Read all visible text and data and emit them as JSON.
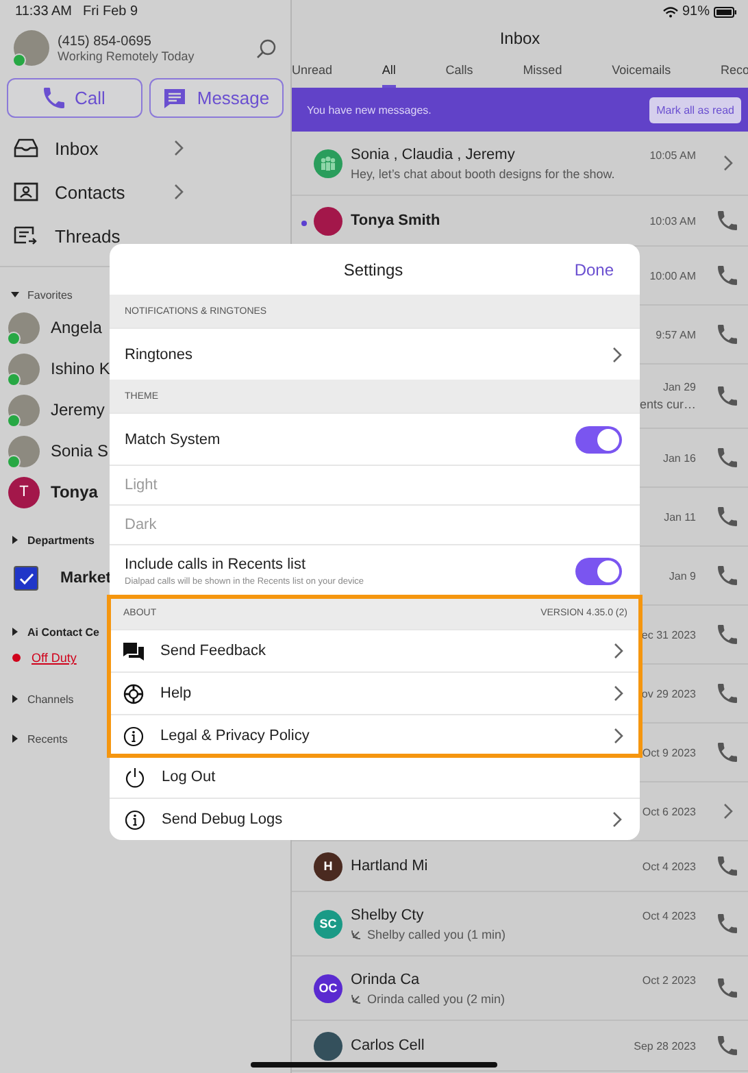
{
  "status_bar": {
    "time": "11:33 AM",
    "date": "Fri Feb 9",
    "battery": "91%"
  },
  "profile": {
    "phone": "(415) 854-0695",
    "status": "Working Remotely Today",
    "online": true
  },
  "actions": [
    {
      "kind": "call",
      "label": "Call"
    },
    {
      "kind": "message",
      "label": "Message"
    }
  ],
  "nav": [
    {
      "kind": "inbox",
      "label": "Inbox",
      "chevron": true
    },
    {
      "kind": "contacts",
      "label": "Contacts",
      "chevron": true
    },
    {
      "kind": "threads",
      "label": "Threads",
      "chevron": false
    }
  ],
  "sidebar_groups": [
    {
      "title": "Favorites",
      "expanded": true,
      "bold": false,
      "items": [
        {
          "kind": "contact",
          "name": "Angela",
          "online": true
        },
        {
          "kind": "contact",
          "name": "Ishino K",
          "online": true
        },
        {
          "kind": "contact",
          "name": "Jeremy",
          "online": true
        },
        {
          "kind": "contact",
          "name": "Sonia S",
          "online": true
        },
        {
          "kind": "contact",
          "name": "Tonya",
          "initial": "T",
          "color": "#a3174a",
          "online": false
        }
      ]
    },
    {
      "title": "Departments",
      "expanded": false,
      "bold": true,
      "items": [
        {
          "kind": "checkbox",
          "name": "Market",
          "checked": true
        }
      ]
    },
    {
      "title": "Ai Contact Ce",
      "expanded": false,
      "bold": true,
      "items": [
        {
          "kind": "status",
          "name": "Off Duty",
          "color": "#d0021b"
        }
      ]
    },
    {
      "title": "Channels",
      "expanded": false,
      "bold": false
    },
    {
      "title": "Recents",
      "expanded": false,
      "bold": false
    }
  ],
  "inbox": {
    "title": "Inbox",
    "tabs": [
      {
        "label": "Unread",
        "selected": false
      },
      {
        "label": "All",
        "selected": true
      },
      {
        "label": "Calls",
        "selected": false
      },
      {
        "label": "Missed",
        "selected": false
      },
      {
        "label": "Voicemails",
        "selected": false
      },
      {
        "label": "Reco",
        "selected": false
      }
    ],
    "banner": {
      "text": "You have new messages.",
      "button": "Mark all as read"
    },
    "rows": [
      {
        "avatar": {
          "kind": "group",
          "color": "#2a9d5c"
        },
        "name": "Sonia , Claudia , Jeremy",
        "time": "10:05 AM",
        "preview": "Hey, let’s chat about booth designs for the show.",
        "kind": "thread",
        "unread": false,
        "call_log": false
      },
      {
        "avatar": {
          "kind": "initials",
          "color": "#a3174a"
        },
        "name": "Tonya Smith",
        "time": "10:03 AM",
        "kind": "call",
        "unread": true
      },
      {
        "time": "10:00 AM",
        "kind": "call"
      },
      {
        "time": "9:57 AM",
        "kind": "call"
      },
      {
        "time": "Jan 29",
        "preview": "ents cur…",
        "kind": "call"
      },
      {
        "time": "Jan 16",
        "kind": "call"
      },
      {
        "time": "Jan 11",
        "kind": "call"
      },
      {
        "time": "Jan 9",
        "kind": "call"
      },
      {
        "time": "ec 31 2023",
        "kind": "call"
      },
      {
        "time": "ov 29 2023",
        "kind": "call"
      },
      {
        "time": "Oct 9 2023",
        "kind": "call"
      },
      {
        "time": "Oct 6 2023",
        "kind": "thread"
      },
      {
        "avatar": {
          "kind": "initials",
          "initials": "H",
          "color": "#4a2a20"
        },
        "name": "Hartland Mi",
        "time": "Oct 4 2023",
        "kind": "call",
        "unread": false
      },
      {
        "avatar": {
          "kind": "initials",
          "initials": "SC",
          "color": "#1a9a86"
        },
        "name": "Shelby Cty",
        "time": "Oct 4 2023",
        "preview": "Shelby called you (1 min)",
        "kind": "call",
        "unread": false,
        "call_log": true
      },
      {
        "avatar": {
          "kind": "initials",
          "initials": "OC",
          "color": "#5a2ad0"
        },
        "name": "Orinda Ca",
        "time": "Oct 2 2023",
        "preview": "Orinda called you (2 min)",
        "kind": "call",
        "unread": false,
        "call_log": true
      },
      {
        "avatar": {
          "kind": "photo",
          "color": "#34505c"
        },
        "name": "Carlos Cell",
        "time": "Sep 28 2023",
        "kind": "call",
        "unread": false
      }
    ]
  },
  "settings": {
    "title": "Settings",
    "done": "Done",
    "sections": [
      {
        "title": "NOTIFICATIONS & RINGTONES",
        "highlighted": false,
        "rows": [
          {
            "kind": "link",
            "label": "Ringtones"
          }
        ]
      },
      {
        "title": "THEME",
        "highlighted": false,
        "rows": [
          {
            "kind": "toggle",
            "label": "Match System",
            "on": true
          },
          {
            "kind": "option",
            "label": "Light",
            "disabled": true
          },
          {
            "kind": "option",
            "label": "Dark",
            "disabled": true
          },
          {
            "kind": "toggle",
            "label": "Include calls in Recents list",
            "subtitle": "Dialpad calls will be shown in the Recents list on your device",
            "on": true
          }
        ]
      },
      {
        "title": "ABOUT",
        "meta": "VERSION 4.35.0 (2)",
        "highlighted": true,
        "rows": [
          {
            "kind": "feedback",
            "label": "Send Feedback"
          },
          {
            "kind": "help",
            "label": "Help"
          },
          {
            "kind": "info",
            "label": "Legal & Privacy Policy"
          }
        ]
      },
      {
        "highlighted": false,
        "rows": [
          {
            "kind": "logout",
            "label": "Log Out"
          },
          {
            "kind": "info",
            "label": "Send Debug Logs"
          }
        ]
      }
    ]
  }
}
